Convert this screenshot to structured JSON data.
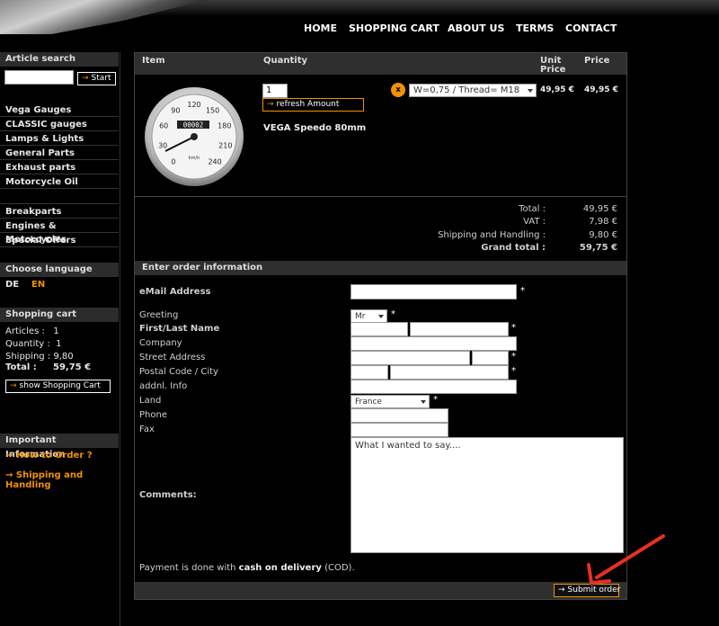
{
  "nav": [
    "HOME",
    "SHOPPING CART",
    "ABOUT US",
    "TERMS",
    "CONTACT"
  ],
  "sidebar": {
    "search_title": "Article search",
    "search_button": "Start",
    "categories_a": [
      "Vega Gauges",
      "CLASSIC gauges",
      "Lamps & Lights",
      "General Parts",
      "Exhaust parts",
      "Motorcycle Oil"
    ],
    "categories_b": [
      "Breakparts",
      "Engines & Motorcycles",
      "Special Offers"
    ],
    "language_title": "Choose language",
    "lang_de": "DE",
    "lang_en": "EN",
    "cart_title": "Shopping cart",
    "cart_articles": "Articles :   1",
    "cart_quantity": "Quantity :  1",
    "cart_shipping": "Shipping : 9,80",
    "cart_total_label": "Total :",
    "cart_total_value": "59,75 €",
    "show_cart_button": "show Shopping Cart",
    "info_title": "Important Information",
    "info_links": [
      "How to Order ?",
      "Shipping and Handling"
    ]
  },
  "table": {
    "col_item": "Item",
    "col_quantity": "Quantity",
    "col_unit_price_1": "Unit",
    "col_unit_price_2": "Price",
    "col_price": "Price",
    "product_name": "VEGA Speedo 80mm",
    "quantity_value": "1",
    "refresh_button": "refresh Amount",
    "variant_selected": "W=0,75 / Thread= M18",
    "unit_price": "49,95 €",
    "price": "49,95 €",
    "remove_icon": "x"
  },
  "summary": {
    "total_label": "Total :",
    "total_value": "49,95 €",
    "vat_label": "VAT :",
    "vat_value": "7,98 €",
    "shipping_label": "Shipping and Handling :",
    "shipping_value": "9,80 €",
    "grand_label": "Grand total :",
    "grand_value": "59,75 €"
  },
  "form": {
    "section_title": "Enter order information",
    "email_label": "eMail Address",
    "greeting_label": "Greeting",
    "greeting_value": "Mr",
    "name_label": "First/Last Name",
    "company_label": "Company",
    "street_label": "Street Address",
    "postal_label": "Postal Code / City",
    "addnl_label": "addnl. Info",
    "land_label": "Land",
    "land_value": "France",
    "phone_label": "Phone",
    "fax_label": "Fax",
    "comments_label": "Comments:",
    "comments_value": "What I wanted to say....",
    "required_mark": "*",
    "payment_pre": "Payment is done with ",
    "payment_bold": "cash on delivery",
    "payment_post": " (COD).",
    "submit_button": "Submit order"
  },
  "speedo": {
    "ticks": [
      "0",
      "30",
      "60",
      "90",
      "120",
      "150",
      "180",
      "210",
      "240"
    ],
    "odometer": "00002",
    "unit": "km/h"
  }
}
